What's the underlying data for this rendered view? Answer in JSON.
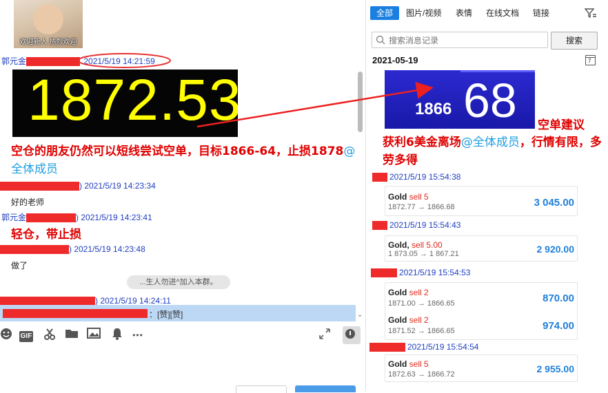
{
  "chat": {
    "avatar_caption": "欢迎新人 热烈欢迎",
    "msg1": {
      "sender_prefix": "郭元金",
      "time": "2021/5/19 14:21:59",
      "ticker": "1872.53"
    },
    "annotation1": {
      "text": "空仓的朋友仍然可以短线尝试空单，目标1866-64，止损1878",
      "mention": "@全体成员"
    },
    "msg2": {
      "time_suffix": ") 2021/5/19 14:23:34",
      "body": "好的老师"
    },
    "msg3": {
      "sender_prefix": "郭元金",
      "time": ") 2021/5/19 14:23:41"
    },
    "annotation2": "轻仓，带止损",
    "msg4": {
      "time_suffix": ") 2021/5/19 14:23:48",
      "body": "做了"
    },
    "system_notice": "...生人勿进^加入本群。",
    "msg5": {
      "time_suffix": ") 2021/5/19 14:24:11"
    },
    "quote_text": "：[赞][赞]"
  },
  "toolbar": {
    "icons": [
      "emoji-icon",
      "gif-icon",
      "scissors-icon",
      "folder-icon",
      "image-icon",
      "bell-icon",
      "more-icon"
    ],
    "gif_label": "GIF",
    "more_label": "•••"
  },
  "history": {
    "tabs": [
      "全部",
      "图片/视频",
      "表情",
      "在线文档",
      "链接"
    ],
    "search_placeholder": "搜索消息记录",
    "search_button": "搜索",
    "date": "2021-05-19",
    "ticker_small": "1866",
    "ticker_big": "68",
    "annotation_right_1": "空单建议",
    "annotation_right_2": "获利6美金离场",
    "annotation_right_mention": "@全体成员",
    "annotation_right_3": "，行情有限，多劳多得",
    "entries": [
      {
        "time": "2021/5/19 15:54:38"
      },
      {
        "time": "2021/5/19 15:54:43"
      },
      {
        "time": "2021/5/19 15:54:53"
      },
      {
        "time": "2021/5/19 15:54:54"
      }
    ],
    "trades": [
      {
        "symbol": "Gold",
        "side": "sell 5",
        "prices": "1872.77 → 1866.68",
        "profit": "3 045.00"
      },
      {
        "symbol": "Gold,",
        "side": "sell 5.00",
        "prices": "1 873.05 → 1 867.21",
        "profit": "2 920.00"
      },
      {
        "symbol": "Gold",
        "side": "sell 2",
        "prices": "1871.00 → 1866.65",
        "profit": "870.00"
      },
      {
        "symbol": "Gold",
        "side": "sell 2",
        "prices": "1871.52 → 1866.65",
        "profit": "974.00"
      },
      {
        "symbol": "Gold",
        "side": "sell 5",
        "prices": "1872.63 → 1866.72",
        "profit": "2 955.00"
      }
    ]
  },
  "colors": {
    "accent": "#1a7fe0",
    "annotation": "#e00000",
    "profit": "#1f7fd8",
    "sell": "#e0281c"
  }
}
